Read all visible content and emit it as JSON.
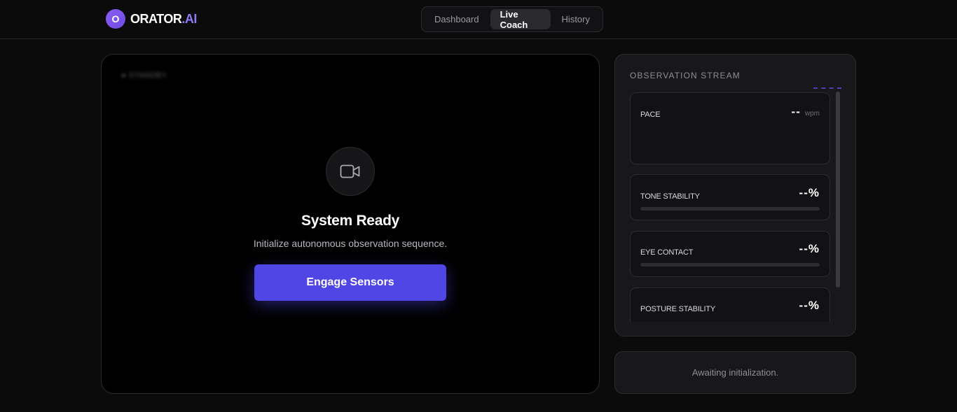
{
  "brand": {
    "logo_letter": "O",
    "name": "ORATOR",
    "suffix": ".AI"
  },
  "nav": {
    "tabs": [
      {
        "label": "Dashboard",
        "active": false
      },
      {
        "label": "Live Coach",
        "active": true
      },
      {
        "label": "History",
        "active": false
      }
    ]
  },
  "stage": {
    "badge": "● STANDBY",
    "camera_icon": "video-camera-icon",
    "title": "System Ready",
    "subtitle": "Initialize autonomous observation sequence.",
    "button_label": "Engage Sensors"
  },
  "observation": {
    "title": "OBSERVATION STREAM",
    "metrics": [
      {
        "label": "PACE",
        "value": "--",
        "unit": "wpm"
      },
      {
        "label": "TONE STABILITY",
        "value": "--%",
        "progress": 0
      },
      {
        "label": "EYE CONTACT",
        "value": "--%",
        "progress": 0
      },
      {
        "label": "POSTURE STABILITY",
        "value": "--%",
        "progress": 0
      }
    ]
  },
  "status": {
    "text": "Awaiting initialization."
  },
  "colors": {
    "accent": "#5046e5",
    "brand_gradient_start": "#8b5cf6",
    "background": "#0b0b0c",
    "panel": "#18181b"
  }
}
